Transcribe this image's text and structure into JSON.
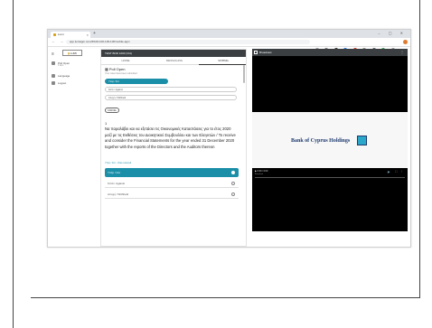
{
  "browser": {
    "tab_title": "Lumi",
    "url": "app.lumiagm.com/#/100-100-100-100/mobile-agm"
  },
  "sidebar": {
    "logo_text": "LUMI",
    "items": [
      {
        "label": "Poll Open",
        "sub": "1 item"
      },
      {
        "label": "Language"
      },
      {
        "label": "Logout"
      }
    ]
  },
  "left_panel": {
    "header": "TEST BOD 1000 (VIA)",
    "tabs": [
      "HOME",
      "MESSAGING",
      "VOTING"
    ],
    "poll_title": "Poll Open",
    "poll_sub": "Your votes have been submitted",
    "small_options": [
      "Υπέρ / For",
      "Κατά / Against",
      "Αποχή / Withheld"
    ],
    "cancel_label": "CANCEL",
    "question_number": "1",
    "question_text": "Να παραλάβει και να εξετάσει τις Οικονομικές Καταστάσεις για το έτος 2020 μαζί με τις Εκθέσεις του Διοικητικού Συμβουλίου και των Ελεγκτών / To receive and consider the Financial Statements for the year ended 31 December 2020 together with the reports of the Directors and the Auditors thereon",
    "question_footer": "Υπέρ / For - Vote received",
    "big_options": [
      "Υπέρ / For",
      "Κατά / Against",
      "Αποχή / Withheld"
    ]
  },
  "right_panel": {
    "header": "Broadcast",
    "slide_title": "Bank of Cyprus Holdings",
    "video_time": "0:00 / 0:00",
    "video_sub": "Broadcast"
  }
}
